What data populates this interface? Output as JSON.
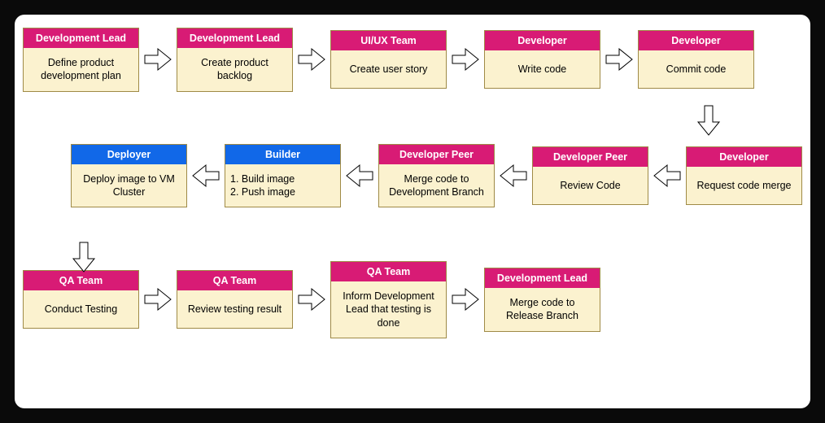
{
  "colors": {
    "pink": "#d81b75",
    "blue": "#1168e8",
    "body": "#fbf2cf",
    "border": "#9f8a46"
  },
  "row1": [
    {
      "role": "Development Lead",
      "role_color": "pink",
      "task": "Define product development plan"
    },
    {
      "role": "Development Lead",
      "role_color": "pink",
      "task": "Create product backlog"
    },
    {
      "role": "UI/UX Team",
      "role_color": "pink",
      "task": "Create user story"
    },
    {
      "role": "Developer",
      "role_color": "pink",
      "task": "Write code"
    },
    {
      "role": "Developer",
      "role_color": "pink",
      "task": "Commit code"
    }
  ],
  "row2": [
    {
      "role": "Developer",
      "role_color": "pink",
      "task": "Request code merge"
    },
    {
      "role": "Developer Peer",
      "role_color": "pink",
      "task": "Review Code"
    },
    {
      "role": "Developer Peer",
      "role_color": "pink",
      "task": "Merge code to Development Branch"
    },
    {
      "role": "Builder",
      "role_color": "blue",
      "task": "1. Build image\n2. Push image"
    },
    {
      "role": "Deployer",
      "role_color": "blue",
      "task": "Deploy image to VM Cluster"
    }
  ],
  "row3": [
    {
      "role": "QA Team",
      "role_color": "pink",
      "task": "Conduct Testing"
    },
    {
      "role": "QA Team",
      "role_color": "pink",
      "task": "Review testing result"
    },
    {
      "role": "QA Team",
      "role_color": "pink",
      "task": "Inform Development Lead that testing is done"
    },
    {
      "role": "Development Lead",
      "role_color": "pink",
      "task": "Merge code to Release Branch"
    }
  ]
}
